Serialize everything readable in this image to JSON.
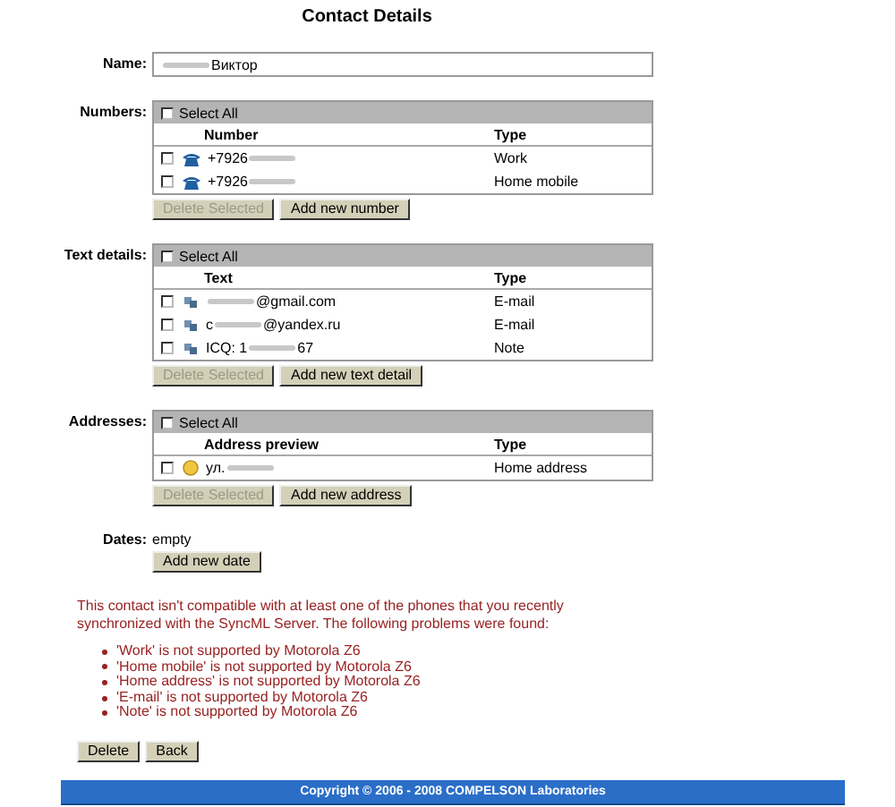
{
  "title": "Contact Details",
  "name_field": {
    "label": "Name:",
    "after": "Виктор"
  },
  "sections": [
    {
      "label": "Numbers:",
      "select_all": {
        "label": "Select All",
        "checked": false
      },
      "columns": [
        "Number",
        "Type"
      ],
      "rows": [
        {
          "kind": "phone",
          "before": "+7926",
          "type": "Work",
          "checked": false
        },
        {
          "kind": "phone",
          "before": "+7926",
          "type": "Home mobile",
          "checked": false
        }
      ],
      "buttons": [
        {
          "label": "Delete Selected",
          "disabled": true
        },
        {
          "label": "Add new number",
          "disabled": false
        }
      ]
    },
    {
      "label": "Text details:",
      "select_all": {
        "label": "Select All",
        "checked": false
      },
      "columns": [
        "Text",
        "Type"
      ],
      "rows": [
        {
          "kind": "text",
          "after": "@gmail.com",
          "type": "E-mail",
          "checked": false
        },
        {
          "kind": "text",
          "before": "c",
          "after": "@yandex.ru",
          "type": "E-mail",
          "checked": false
        },
        {
          "kind": "text",
          "before": "ICQ: 1",
          "after": "67",
          "type": "Note",
          "checked": false
        }
      ],
      "buttons": [
        {
          "label": "Delete Selected",
          "disabled": true
        },
        {
          "label": "Add new text detail",
          "disabled": false
        }
      ]
    },
    {
      "label": "Addresses:",
      "select_all": {
        "label": "Select All",
        "checked": false
      },
      "columns": [
        "Address preview",
        "Type"
      ],
      "rows": [
        {
          "kind": "address",
          "before": "ул.",
          "type": "Home address",
          "checked": false
        }
      ],
      "buttons": [
        {
          "label": "Delete Selected",
          "disabled": true
        },
        {
          "label": "Add new address",
          "disabled": false
        }
      ]
    }
  ],
  "dates": {
    "label": "Dates:",
    "value": "empty",
    "button": "Add new date"
  },
  "warning": "This contact isn't compatible with at least one of the phones that you recently synchronized with the SyncML Server. The following problems were found:",
  "problems": [
    "'Work' is not supported by Motorola Z6",
    "'Home mobile' is not supported by Motorola Z6",
    "'Home address' is not supported by Motorola Z6",
    "'E-mail' is not supported by Motorola Z6",
    "'Note' is not supported by Motorola Z6"
  ],
  "actions": [
    "Delete",
    "Back"
  ],
  "footer": "Copyright © 2006 - 2008 COMPELSON Laboratories"
}
